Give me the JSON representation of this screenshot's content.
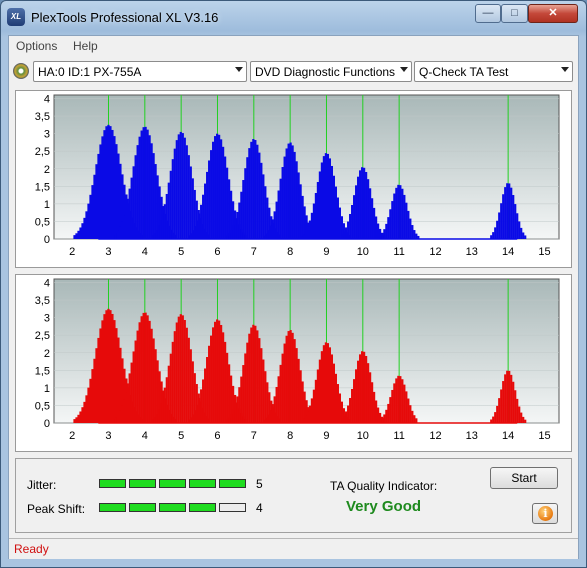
{
  "window": {
    "title": "PlexTools Professional XL V3.16",
    "icon_label": "XL"
  },
  "menu": [
    {
      "label": "Options"
    },
    {
      "label": "Help"
    }
  ],
  "toolbar": {
    "drive": "HA:0 ID:1  PX-755A",
    "function": "DVD Diagnostic Functions",
    "test": "Q-Check TA Test"
  },
  "chart_data": [
    {
      "type": "bar",
      "name": "",
      "color": "#0a0ae6",
      "xlim": [
        1.5,
        15.4
      ],
      "ylim": [
        0,
        4.1
      ],
      "xticks": [
        "2",
        "3",
        "4",
        "5",
        "6",
        "7",
        "8",
        "9",
        "10",
        "11",
        "12",
        "13",
        "14",
        "15"
      ],
      "yticks": [
        "0",
        "0,5",
        "1",
        "1,5",
        "2",
        "2,5",
        "3",
        "3,5",
        "4"
      ],
      "grid": true,
      "markers": [
        3,
        4,
        5,
        6,
        7,
        8,
        9,
        10,
        11,
        14
      ],
      "peaks": [
        {
          "center": 3,
          "height": 3.25,
          "width": 0.36
        },
        {
          "center": 4,
          "height": 3.2,
          "width": 0.33
        },
        {
          "center": 5,
          "height": 3.05,
          "width": 0.3
        },
        {
          "center": 6,
          "height": 3.0,
          "width": 0.3
        },
        {
          "center": 7,
          "height": 2.85,
          "width": 0.28
        },
        {
          "center": 8,
          "height": 2.75,
          "width": 0.27
        },
        {
          "center": 9,
          "height": 2.45,
          "width": 0.26
        },
        {
          "center": 10,
          "height": 2.05,
          "width": 0.24
        },
        {
          "center": 11,
          "height": 1.55,
          "width": 0.22
        },
        {
          "center": 14,
          "height": 1.6,
          "width": 0.2
        }
      ]
    },
    {
      "type": "bar",
      "name": "",
      "color": "#e60a0a",
      "xlim": [
        1.5,
        15.4
      ],
      "ylim": [
        0,
        4.1
      ],
      "xticks": [
        "2",
        "3",
        "4",
        "5",
        "6",
        "7",
        "8",
        "9",
        "10",
        "11",
        "12",
        "13",
        "14",
        "15"
      ],
      "yticks": [
        "0",
        "0,5",
        "1",
        "1,5",
        "2",
        "2,5",
        "3",
        "3,5",
        "4"
      ],
      "grid": true,
      "markers": [
        3,
        4,
        5,
        6,
        7,
        8,
        9,
        10,
        11,
        14
      ],
      "peaks": [
        {
          "center": 3,
          "height": 3.25,
          "width": 0.36
        },
        {
          "center": 4,
          "height": 3.15,
          "width": 0.33
        },
        {
          "center": 5,
          "height": 3.1,
          "width": 0.3
        },
        {
          "center": 6,
          "height": 2.95,
          "width": 0.3
        },
        {
          "center": 7,
          "height": 2.8,
          "width": 0.28
        },
        {
          "center": 8,
          "height": 2.65,
          "width": 0.27
        },
        {
          "center": 9,
          "height": 2.3,
          "width": 0.26
        },
        {
          "center": 10,
          "height": 2.05,
          "width": 0.24
        },
        {
          "center": 11,
          "height": 1.35,
          "width": 0.22
        },
        {
          "center": 14,
          "height": 1.5,
          "width": 0.2
        }
      ]
    }
  ],
  "results": {
    "jitter_label": "Jitter:",
    "jitter_value": "5",
    "jitter_level": 5,
    "peak_shift_label": "Peak Shift:",
    "peak_shift_value": "4",
    "peak_shift_level": 4,
    "meter_max": 5,
    "ta_label": "TA Quality Indicator:",
    "ta_value": "Very Good",
    "ta_color": "#1e8a1e",
    "start_label": "Start",
    "info_icon": "info-icon"
  },
  "status": {
    "text": "Ready",
    "color": "#d01010"
  }
}
